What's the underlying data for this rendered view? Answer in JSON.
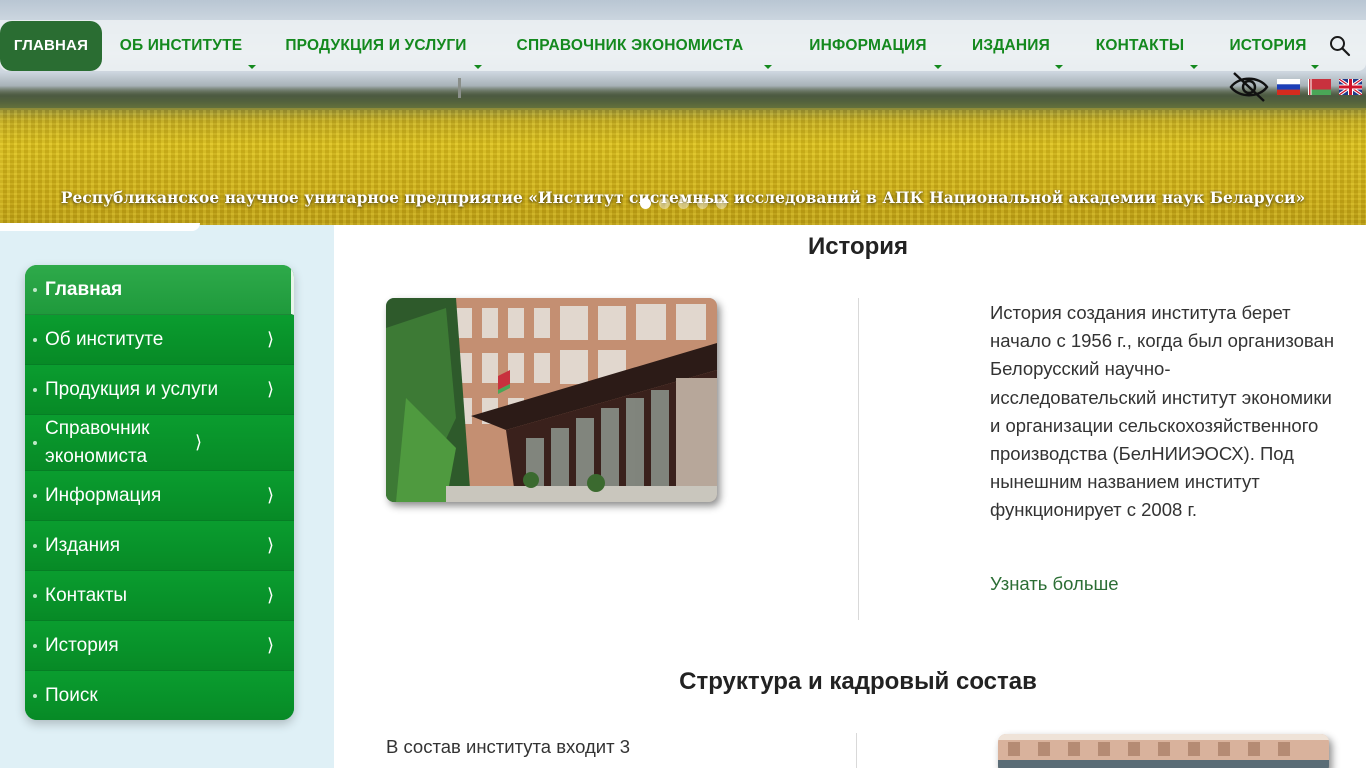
{
  "header": {
    "tagline": "Республиканское научное унитарное предприятие «Институт системных исследований в АПК Национальной академии наук Беларуси»",
    "slider_dots": 5,
    "slider_active": 1
  },
  "topnav": {
    "items": [
      {
        "label": "ГЛАВНАЯ",
        "has_submenu": false
      },
      {
        "label": "ОБ ИНСТИТУТЕ",
        "has_submenu": true
      },
      {
        "label": "ПРОДУКЦИЯ И УСЛУГИ",
        "has_submenu": true
      },
      {
        "label": "СПРАВОЧНИК ЭКОНОМИСТА",
        "has_submenu": true
      },
      {
        "label": "ИНФОРМАЦИЯ",
        "has_submenu": true
      },
      {
        "label": "ИЗДАНИЯ",
        "has_submenu": true
      },
      {
        "label": "КОНТАКТЫ",
        "has_submenu": true
      },
      {
        "label": "ИСТОРИЯ",
        "has_submenu": true
      }
    ],
    "search_icon": "search-icon"
  },
  "utility": {
    "accessibility_icon": "eye-slash-icon",
    "languages": [
      "ru",
      "by",
      "en"
    ]
  },
  "sidebar": {
    "items": [
      {
        "label": "Главная",
        "arrow": ""
      },
      {
        "label": "Об институте",
        "arrow": "⟩"
      },
      {
        "label": "Продукция и услуги",
        "arrow": "⟩"
      },
      {
        "label": "Справочник экономиста",
        "arrow": "⟩"
      },
      {
        "label": "Информация",
        "arrow": "⟩"
      },
      {
        "label": "Издания",
        "arrow": "⟩"
      },
      {
        "label": "Контакты",
        "arrow": "⟩"
      },
      {
        "label": "История",
        "arrow": "⟩"
      },
      {
        "label": "Поиск",
        "arrow": ""
      }
    ]
  },
  "main": {
    "history": {
      "title": "История",
      "text": "История создания института берет начало с 1956 г., когда был организован Белорусский научно-исследовательский институт экономики и организации сельскохозяйственного производства (БелНИИЭОСХ). Под нынешним названием институт функционирует с 2008 г.",
      "more_label": "Узнать больше"
    },
    "structure": {
      "title": "Структура и кадровый состав",
      "text": "В состав института входит 3"
    }
  },
  "colors": {
    "brand_green": "#14891e",
    "home_bg": "#2a6d32",
    "menu_green": "#0a8f2c",
    "sidebar_bg": "#dff0f6",
    "link_green": "#2c6e35"
  }
}
